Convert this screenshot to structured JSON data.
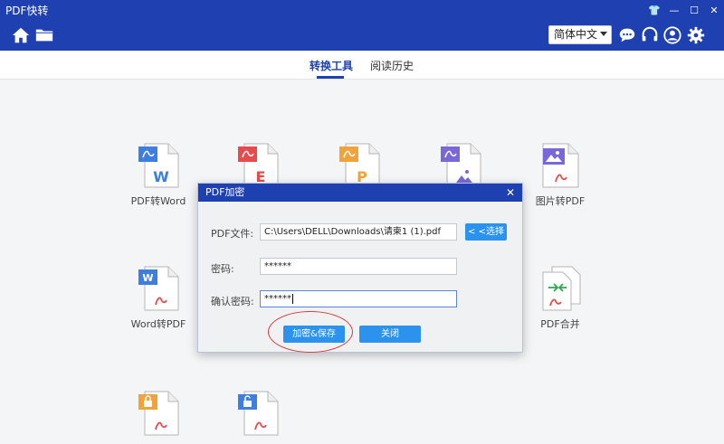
{
  "app": {
    "title": "PDF快转",
    "window_controls": {
      "skin": "👕",
      "minimize": "—",
      "maximize": "☐",
      "close": "✕"
    }
  },
  "toolbar": {
    "home_icon": "home-icon",
    "folder_icon": "folder-icon",
    "language": "简体中文",
    "right_icons": [
      "chat-icon",
      "headset-icon",
      "user-icon",
      "gear-icon"
    ]
  },
  "tabs": [
    {
      "label": "转换工具",
      "active": true
    },
    {
      "label": "阅读历史",
      "active": false
    }
  ],
  "tools": [
    {
      "label": "PDF转Word",
      "badge": "W",
      "color": "#3d7ede"
    },
    {
      "label": "",
      "badge": "E",
      "color": "#e84b4b"
    },
    {
      "label": "",
      "badge": "P",
      "color": "#f0a33a"
    },
    {
      "label": "",
      "badge": "image-icon",
      "color": "#7b68d8"
    },
    {
      "label": "图片转PDF",
      "badge": "image-icon",
      "color": "#7b68d8"
    },
    {
      "label": "Word转PDF",
      "badge": "W",
      "color": "#3d7ede"
    },
    {
      "label": "PDF合并",
      "badge": "merge-icon",
      "color": "#2fa84f"
    },
    {
      "label": "",
      "badge": "lock-icon",
      "color": "#f0a33a"
    },
    {
      "label": "",
      "badge": "unlock-icon",
      "color": "#3d7ede"
    }
  ],
  "dialog": {
    "title": "PDF加密",
    "close": "✕",
    "file_label": "PDF文件:",
    "file_value": "C:\\Users\\DELL\\Downloads\\请柬1 (1).pdf",
    "choose_button": "< <选择",
    "password_label": "密码:",
    "password_value": "******",
    "confirm_label": "确认密码:",
    "confirm_value": "******",
    "encrypt_button": "加密&保存",
    "close_button": "关闭"
  }
}
